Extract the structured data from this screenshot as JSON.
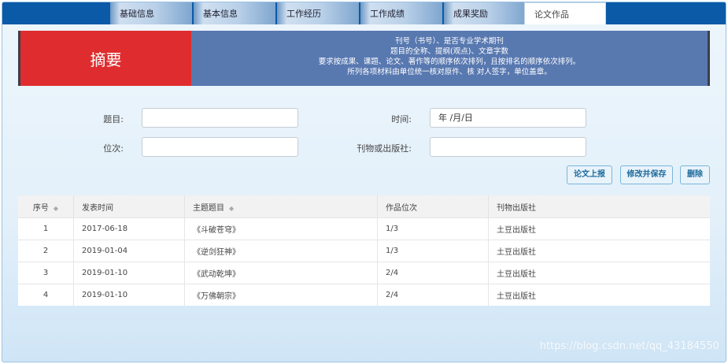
{
  "tabs": [
    "基础信息",
    "基本信息",
    "工作经历",
    "工作成绩",
    "成果奖励",
    "论文作品"
  ],
  "banner": {
    "title": "摘要",
    "lines": [
      "刊号（书号）、是否专业学术期刊",
      "题目的全称、提纲(观点)、文章字数",
      "要求按成果、课题、论文、著作等的顺序依次排列，且按排名的顺序依次排列。",
      "所列各项材料由单位统一核对原件、核 对人签字，单位盖章。"
    ]
  },
  "form": {
    "title_label": "题目:",
    "title_value": "",
    "time_label": "时间:",
    "time_value": "年 /月/日",
    "rank_label": "位次:",
    "rank_value": "",
    "publisher_label": "刊物或出版社:",
    "publisher_value": ""
  },
  "buttons": {
    "upload": "论文上报",
    "save": "修改并保存",
    "delete": "删除"
  },
  "table": {
    "headers": [
      "序号",
      "发表时间",
      "主题题目",
      "作品位次",
      "刊物出版社"
    ],
    "rows": [
      [
        "1",
        "2017-06-18",
        "《斗破苍穹》",
        "1/3",
        "土豆出版社"
      ],
      [
        "2",
        "2019-01-04",
        "《逆剑狂神》",
        "1/3",
        "土豆出版社"
      ],
      [
        "3",
        "2019-01-10",
        "《武动乾坤》",
        "2/4",
        "土豆出版社"
      ],
      [
        "4",
        "2019-01-10",
        "《万佛朝宗》",
        "2/4",
        "土豆出版社"
      ]
    ]
  },
  "watermark": "https://blog.csdn.net/qq_43184550"
}
